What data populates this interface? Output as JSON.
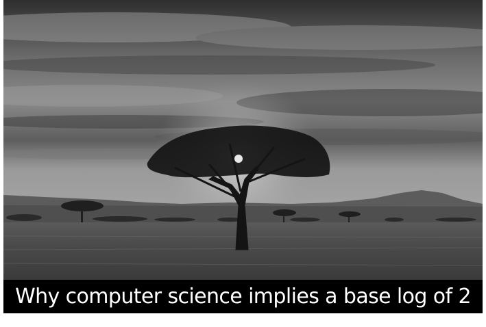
{
  "photo": {
    "subject": "acacia-tree-savanna-sunset",
    "tone": "black-and-white"
  },
  "caption": {
    "text": "Why computer science implies a base log of 2",
    "background": "#000000",
    "color": "#ffffff"
  }
}
